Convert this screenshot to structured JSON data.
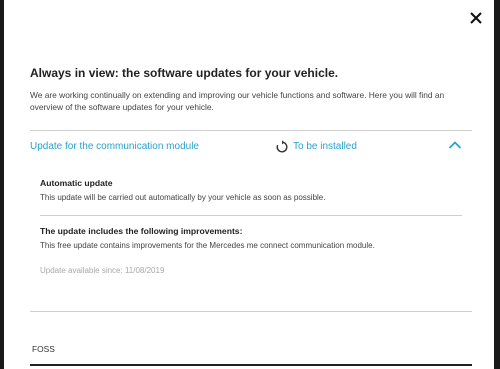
{
  "modal": {
    "title": "Always in view: the software updates for your vehicle.",
    "intro": "We are working continually on extending and improving our vehicle functions and software. Here you will find an overview of the software updates for your vehicle."
  },
  "update": {
    "title": "Update for the communication module",
    "status": "To be installed",
    "status_icon": "refresh-icon",
    "expanded": true,
    "sections": [
      {
        "heading": "Automatic update",
        "text": "This update will be carried out automatically by your vehicle as soon as possible."
      },
      {
        "heading": "The update includes the following improvements:",
        "text": "This free update contains improvements for the Mercedes me connect communication module."
      }
    ],
    "available": "Update available since: 11/08/2019"
  },
  "foss": {
    "label": "FOSS"
  },
  "colors": {
    "accent": "#2aa2cc",
    "text": "#222222",
    "muted": "#a8a8a8"
  }
}
